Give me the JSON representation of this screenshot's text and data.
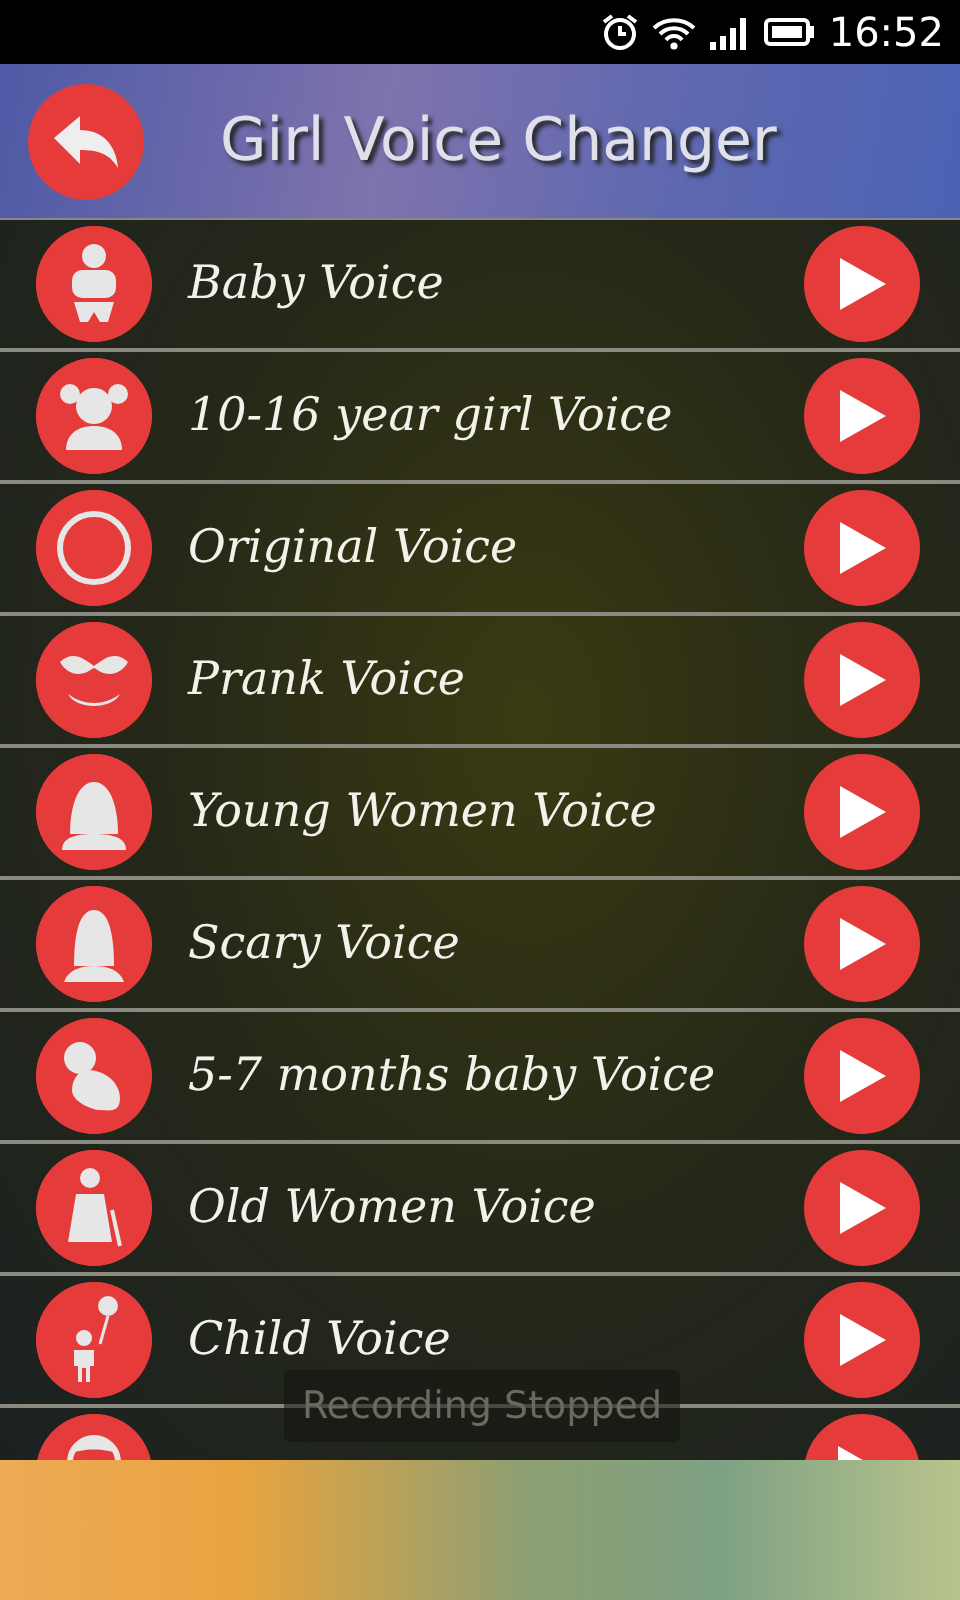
{
  "status_bar": {
    "time": "16:52"
  },
  "header": {
    "title": "Girl Voice Changer"
  },
  "voices": [
    {
      "kind": "voice",
      "label": "Baby Voice"
    },
    {
      "kind": "voice",
      "label": "10-16 year girl Voice"
    },
    {
      "kind": "voice",
      "label": "Original Voice"
    },
    {
      "kind": "voice",
      "label": "Prank Voice"
    },
    {
      "kind": "voice",
      "label": "Young Women Voice"
    },
    {
      "kind": "voice",
      "label": "Scary Voice"
    },
    {
      "kind": "voice",
      "label": "5-7 months baby Voice"
    },
    {
      "kind": "voice",
      "label": "Old Women Voice"
    },
    {
      "kind": "voice",
      "label": "Child Voice"
    },
    {
      "kind": "partial"
    }
  ],
  "toast": {
    "text": "Recording Stopped"
  },
  "banner": {
    "kind": "ad"
  }
}
